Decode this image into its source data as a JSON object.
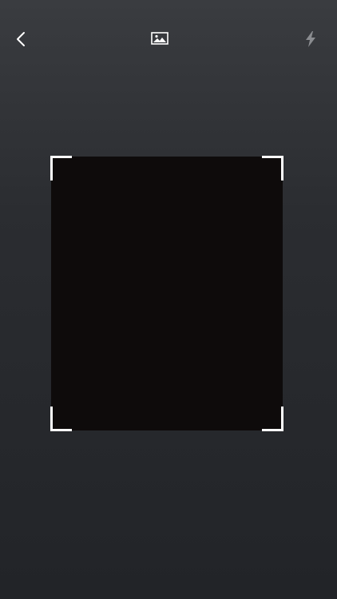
{
  "toolbar": {
    "back": {
      "icon": "chevron-left-icon",
      "color": "#ffffff"
    },
    "gallery": {
      "icon": "image-icon",
      "color": "#ffffff"
    },
    "flash": {
      "icon": "flash-icon",
      "color": "#8a8c90"
    }
  },
  "scanner": {
    "frame_color": "#ffffff",
    "viewfinder_color": "#0e0b0b"
  }
}
